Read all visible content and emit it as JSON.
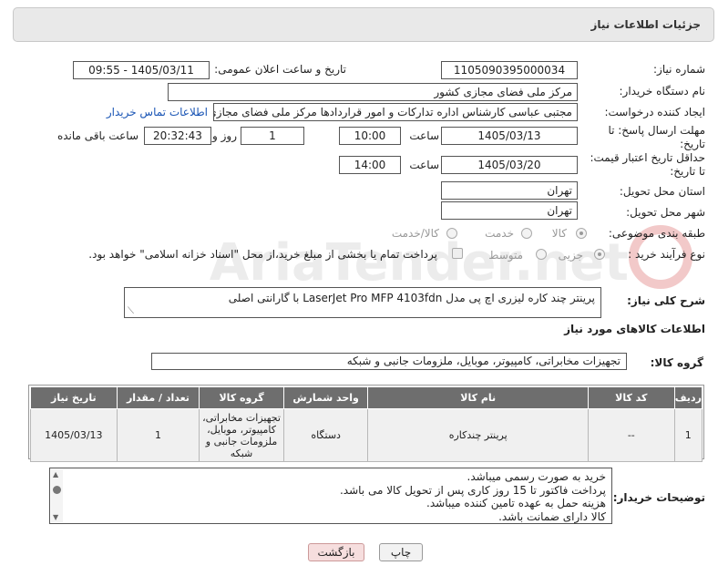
{
  "header": {
    "title": "جزئیات اطلاعات نیاز"
  },
  "fields": {
    "need_number": {
      "label": "شماره نیاز:",
      "value": "1105090395000034"
    },
    "announce_datetime": {
      "label": "تاریخ و ساعت اعلان عمومی:",
      "value": "1405/03/11 - 09:55"
    },
    "buyer_org": {
      "label": "نام دستگاه خریدار:",
      "value": "مرکز ملی فضای مجازی کشور"
    },
    "requester": {
      "label": "ایجاد کننده درخواست:",
      "value": "مجتبی عباسی کارشناس اداره تدارکات و امور قراردادها مرکز ملی فضای مجازی",
      "contact_link": "اطلاعات تماس خریدار"
    },
    "reply_deadline": {
      "label": "مهلت ارسال پاسخ: تا تاریخ:",
      "date": "1405/03/13",
      "time_label": "ساعت",
      "time": "10:00",
      "days": "1",
      "days_label": "روز و",
      "remaining": "20:32:43",
      "remaining_label": "ساعت باقی مانده"
    },
    "price_validity": {
      "label": "حداقل تاریخ اعتبار قیمت: تا تاریخ:",
      "date": "1405/03/20",
      "time_label": "ساعت",
      "time": "14:00"
    },
    "province": {
      "label": "استان محل تحویل:",
      "value": "تهران"
    },
    "city": {
      "label": "شهر محل تحویل:",
      "value": "تهران"
    },
    "category": {
      "label": "طبقه بندی موضوعی:",
      "options": [
        "کالا",
        "خدمت",
        "کالا/خدمت"
      ],
      "selected": "کالا"
    },
    "process": {
      "label": "نوع فرآیند خرید :",
      "options": [
        "جزیی",
        "متوسط"
      ],
      "selected": "جزیی",
      "payment_note": "پرداخت تمام یا بخشی از مبلغ خرید،از محل \"اسناد خزانه اسلامی\" خواهد بود."
    }
  },
  "description": {
    "label": "شرح کلی نیاز:",
    "value": "پرینتر چند کاره لیزری اچ پی مدل LaserJet Pro MFP 4103fdn با گارانتی اصلی"
  },
  "goods_section": {
    "title": "اطلاعات کالاهای مورد نیاز",
    "group_label": "گروه کالا:",
    "group_value": "تجهیزات مخابراتی، کامپیوتر، موبایل، ملزومات جانبی و شبکه"
  },
  "table": {
    "headers": [
      "ردیف",
      "کد کالا",
      "نام کالا",
      "واحد شمارش",
      "گروه کالا",
      "تعداد / مقدار",
      "تاریخ نیاز"
    ],
    "rows": [
      {
        "row": "1",
        "code": "--",
        "name": "پرینتر چندکاره",
        "unit": "دستگاه",
        "group": "تجهیزات مخابراتی، کامپیوتر، موبایل، ملزومات جانبی و شبکه",
        "qty": "1",
        "date": "1405/03/13"
      }
    ]
  },
  "buyer_notes": {
    "label": "توضیحات خریدار:",
    "lines": [
      "خرید به صورت رسمی میباشد.",
      "پرداخت فاکتور تا 15 روز کاری پس از تحویل کالا می باشد.",
      "هزینه حمل به عهده تامین کننده میباشد.",
      "کالا دارای ضمانت باشد."
    ]
  },
  "buttons": {
    "print": "چاپ",
    "back": "بازگشت"
  },
  "watermark": {
    "text": "AriaTender.net"
  }
}
